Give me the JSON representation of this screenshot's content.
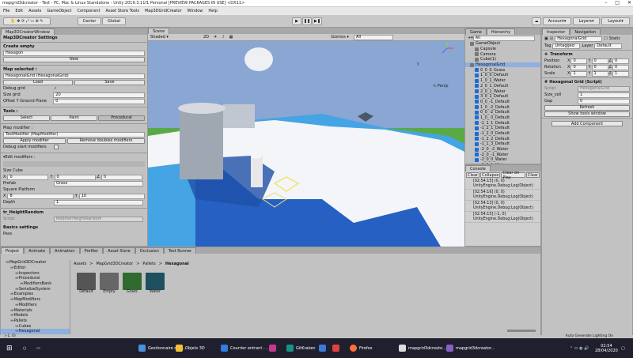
{
  "window": {
    "title": "mapgrid3dcreator - Test - PC, Mac & Linux Standalone - Unity 2019.3.11f1 Personal [PREVIEW PACKAGES IN USE] <DX11>"
  },
  "menu": [
    "File",
    "Edit",
    "Assets",
    "GameObject",
    "Component",
    "Asset Store Tools",
    "Map3DGridCreator",
    "Window",
    "Help"
  ],
  "toolbar": {
    "center": "Center",
    "global": "Global",
    "account": "Account",
    "layers": "Layers",
    "layout": "Layout"
  },
  "left_panel": {
    "tab": "Map3DCreatorWindow",
    "title": "Map3DCreator Settings",
    "create_empty": {
      "header": "Create empty",
      "dropdown": "Hexagon",
      "new_btn": "New"
    },
    "map_selected": {
      "header": "Map selected :",
      "field": "HexagonalGrid (HexagonalGrid)",
      "load": "Load",
      "save": "Save"
    },
    "debug_grid": "Debug grid",
    "size_grid_label": "Size grid",
    "size_grid": "20",
    "offset_label": "Offset Y Ground Plane",
    "offset": "0",
    "tools": {
      "header": "Tools :",
      "select": "Select",
      "paint": "Paint",
      "procedural": "Procedural"
    },
    "map_modifier": {
      "header": "Map modifier :",
      "field": "TestModifier (MapModifier)",
      "apply": "Apply modifier",
      "remove": "Remove doubles modifiers",
      "debug": "Debug start modifiers"
    },
    "edit_modifiers": "Edit modifiers :",
    "size_cube": "Size Cube",
    "x": "X",
    "y": "Y",
    "z": "Z",
    "sx": "0",
    "sy": "0",
    "sz": "0",
    "prefab_label": "Prefab",
    "prefab": "Grass",
    "square_label": "Square Platform",
    "sqx": "8",
    "sqy": "10",
    "depth_label": "Depth",
    "depth": "1",
    "height_random": "tr_HeightRandom",
    "script_label": "Script",
    "script": "ModifierHeightRandom",
    "basics": "Basics settings",
    "pass": "Pass"
  },
  "scene": {
    "tab_scene": "Scene",
    "tab_game": "Game",
    "shaded": "Shaded",
    "mode2d": "2D",
    "gizmos": "Gizmos",
    "search": "All",
    "persp": "< Persp"
  },
  "hierarchy": {
    "tab": "Hierarchy",
    "search": "All",
    "items": [
      {
        "t": "GameObject",
        "d": 1,
        "g": true
      },
      {
        "t": "Capsule",
        "d": 2,
        "g": true
      },
      {
        "t": "Camera",
        "d": 2,
        "g": true
      },
      {
        "t": "Cube(1)",
        "d": 2,
        "g": true
      },
      {
        "t": "HexagonalGrid",
        "d": 1,
        "g": true
      },
      {
        "t": "0_0_0_Grass",
        "d": 2
      },
      {
        "t": "1_0_0_Default",
        "d": 2
      },
      {
        "t": "1_0_1_Water",
        "d": 2
      },
      {
        "t": "2_0_1_Default",
        "d": 2
      },
      {
        "t": "2_0_1_Water",
        "d": 2
      },
      {
        "t": "3_0_1_Default",
        "d": 2
      },
      {
        "t": "0_0_-1_Default",
        "d": 2
      },
      {
        "t": "1_0_-2_Default",
        "d": 2
      },
      {
        "t": "0_0_-2_Default",
        "d": 2
      },
      {
        "t": "1_0_-3_Default",
        "d": 2
      },
      {
        "t": "-1_1_1_Default",
        "d": 2
      },
      {
        "t": "-1_2_1_Default",
        "d": 2
      },
      {
        "t": "-1_2_0_Default",
        "d": 2
      },
      {
        "t": "-1_2_2_Default",
        "d": 2
      },
      {
        "t": "-1_1_3_Default",
        "d": 2
      },
      {
        "t": "-2_0_-2_Water",
        "d": 2
      },
      {
        "t": "-2_0_-1_Water",
        "d": 2
      },
      {
        "t": "-2_0_0_Water",
        "d": 2
      },
      {
        "t": "-2_0_1_Water",
        "d": 2
      },
      {
        "t": "-2_0_2_Water",
        "d": 2
      },
      {
        "t": "-2_0_3_Water",
        "d": 2
      }
    ]
  },
  "console": {
    "tab": "Console",
    "clear": "Clear",
    "collapse": "Collapse",
    "clear_on_play": "Clear on Play",
    "clear2": "Clear",
    "logs": [
      {
        "a": "[02:54:15] (0, 0)",
        "b": "UnityEngine.Debug:Log(Object)"
      },
      {
        "a": "[02:54:16] (0, 0)",
        "b": "UnityEngine.Debug:Log(Object)"
      },
      {
        "a": "[02:54:13] (0, 0)",
        "b": "UnityEngine.Debug:Log(Object)"
      },
      {
        "a": "[02:54:15] (-1, 0)",
        "b": "UnityEngine.Debug:Log(Object)"
      }
    ]
  },
  "inspector": {
    "tab": "Inspector",
    "tab2": "Navigation",
    "name": "HexagonalGrid",
    "static": "Static",
    "tag_label": "Tag",
    "tag": "Untagged",
    "layer_label": "Layer",
    "layer": "Default",
    "transform": "Transform",
    "position": "Position",
    "rotation": "Rotation",
    "scale": "Scale",
    "px": "0",
    "py": "0",
    "pz": "0",
    "rx": "0",
    "ry": "0",
    "rz": "0",
    "scx": "1",
    "scy": "1",
    "scz": "1",
    "component": "Hexagonal Grid (Script)",
    "script_label": "Script",
    "script": "HexagonalGrid",
    "size_cell_label": "Size_cell",
    "size_cell": "1",
    "gap_label": "Gap",
    "gap": "0",
    "refresh": "Refresh",
    "show_tools": "Show tools window",
    "add_component": "Add Component"
  },
  "project": {
    "tab": "Project",
    "tab2": "Animate",
    "tab3": "Animation",
    "tab4": "Profiler",
    "tab5": "Asset Store",
    "tab6": "Occlusion",
    "tab7": "Test Runner",
    "breadcrumb": [
      "Assets",
      "MapGrid3DCreator",
      "Pallets",
      "Hexagonal"
    ],
    "tree": [
      {
        "t": "MapGrid3DCreator",
        "d": 1
      },
      {
        "t": "Editor",
        "d": 2
      },
      {
        "t": "Inspectors",
        "d": 3
      },
      {
        "t": "Procedural",
        "d": 3
      },
      {
        "t": "ModifiersBank",
        "d": 4
      },
      {
        "t": "SerializeSystem",
        "d": 3
      },
      {
        "t": "Examples",
        "d": 2
      },
      {
        "t": "MapModifiers",
        "d": 2
      },
      {
        "t": "Modifiers",
        "d": 3
      },
      {
        "t": "Materials",
        "d": 2
      },
      {
        "t": "Models",
        "d": 2
      },
      {
        "t": "Pallets",
        "d": 2
      },
      {
        "t": "Cubes",
        "d": 3
      },
      {
        "t": "Hexagonal",
        "d": 3
      }
    ],
    "assets": [
      {
        "n": "Default",
        "c": "#555"
      },
      {
        "n": "Empty",
        "c": "#666"
      },
      {
        "n": "Grass",
        "c": "#2f6b2f"
      },
      {
        "n": "Water",
        "c": "#1f5060"
      }
    ],
    "status": "(-1, 0)",
    "autogen": "Auto Generate Lighting On"
  },
  "taskbar": {
    "items": [
      "Gestionnaire des ...",
      "Objets 3D",
      "Courrier entrant - ...",
      "GitKraken",
      "Firefox",
      "mapgrid3dcreato...",
      "mapgrid3dcreator..."
    ],
    "time": "02:54",
    "date": "28/04/2020"
  }
}
